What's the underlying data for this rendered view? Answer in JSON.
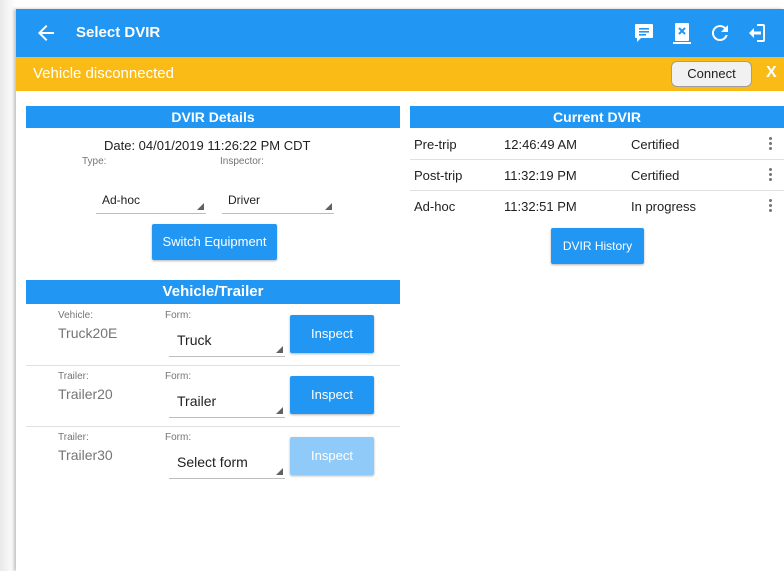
{
  "appbar": {
    "title": "Select DVIR",
    "icons": [
      "back-arrow-icon",
      "message-icon",
      "export-icon",
      "refresh-icon",
      "logout-icon"
    ]
  },
  "banner": {
    "message": "Vehicle disconnected",
    "connect_label": "Connect",
    "close_label": "X"
  },
  "dvir_details": {
    "heading": "DVIR Details",
    "date": "Date: 04/01/2019 11:26:22 PM CDT",
    "type_label": "Type:",
    "type_value": "Ad-hoc",
    "inspector_label": "Inspector:",
    "inspector_value": "Driver",
    "switch_label": "Switch Equipment"
  },
  "vehicle_trailer": {
    "heading": "Vehicle/Trailer",
    "rows": [
      {
        "kind_label": "Vehicle:",
        "name": "Truck20E",
        "form_label": "Form:",
        "form_value": "Truck",
        "inspect_label": "Inspect",
        "enabled": true
      },
      {
        "kind_label": "Trailer:",
        "name": "Trailer20",
        "form_label": "Form:",
        "form_value": "Trailer",
        "inspect_label": "Inspect",
        "enabled": true
      },
      {
        "kind_label": "Trailer:",
        "name": "Trailer30",
        "form_label": "Form:",
        "form_value": "Select form",
        "inspect_label": "Inspect",
        "enabled": false
      }
    ]
  },
  "current_dvir": {
    "heading": "Current DVIR",
    "rows": [
      {
        "type": "Pre-trip",
        "time": "12:46:49 AM",
        "status": "Certified"
      },
      {
        "type": "Post-trip",
        "time": "11:32:19 PM",
        "status": "Certified"
      },
      {
        "type": "Ad-hoc",
        "time": "11:32:51 PM",
        "status": "In progress"
      }
    ],
    "history_label": "DVIR History"
  },
  "colors": {
    "primary": "#2196f3",
    "banner": "#fbbb16",
    "disabled_button": "#90caf9"
  }
}
